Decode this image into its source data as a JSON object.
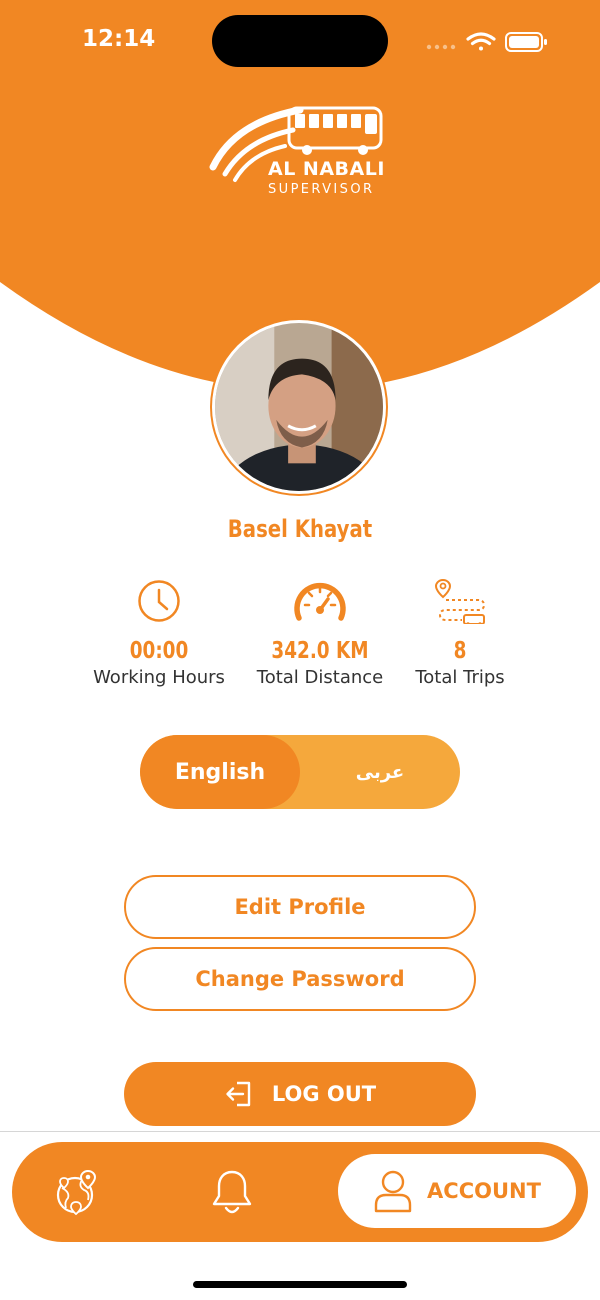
{
  "status_bar": {
    "time": "12:14"
  },
  "brand": {
    "line1": "AL NABALI",
    "line2": "SUPERVISOR"
  },
  "colors": {
    "accent": "#f18723",
    "accent_light": "#f5a83c",
    "text": "#333333",
    "background": "#ffffff"
  },
  "profile": {
    "name": "Basel Khayat"
  },
  "stats": [
    {
      "icon": "clock-icon",
      "value": "00:00",
      "label": "Working Hours"
    },
    {
      "icon": "speedometer-icon",
      "value": "342.0 KM",
      "label": "Total Distance"
    },
    {
      "icon": "route-bus-icon",
      "value": "8",
      "label": "Total Trips"
    }
  ],
  "language": {
    "selected": "English",
    "options": [
      "English",
      "عربى"
    ]
  },
  "actions": {
    "edit_profile": "Edit Profile",
    "change_password": "Change Password",
    "logout": "LOG OUT"
  },
  "tab_bar": {
    "active": "ACCOUNT",
    "account_label": "ACCOUNT",
    "tabs": [
      "map-icon",
      "bell-icon",
      "user-icon"
    ]
  }
}
